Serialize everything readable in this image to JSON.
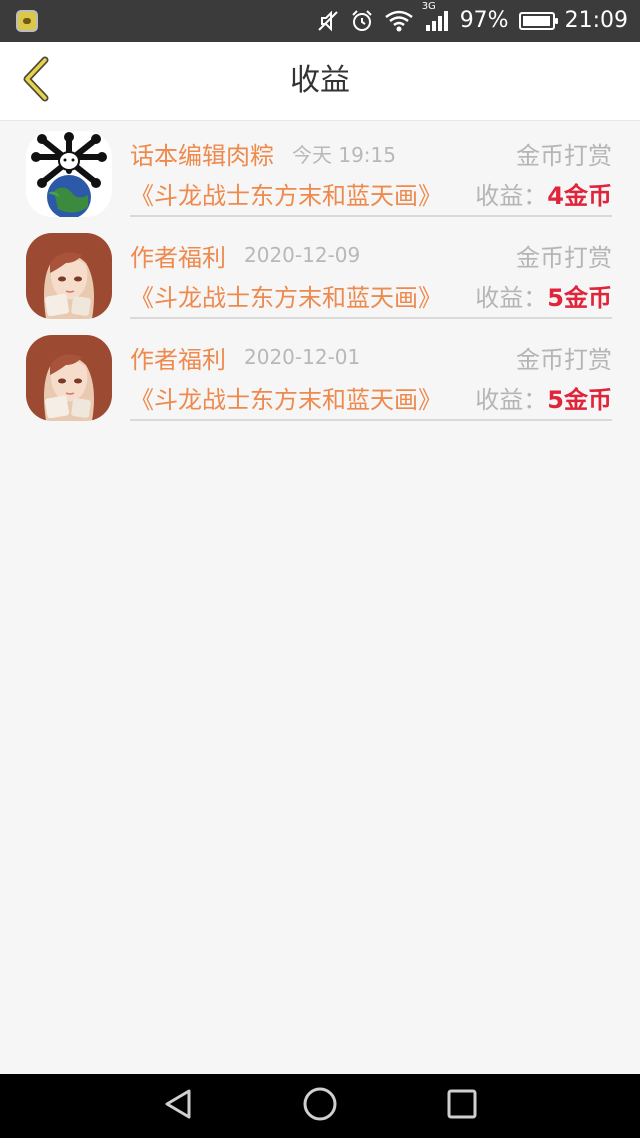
{
  "status_bar": {
    "battery_percent_text": "97%",
    "time": "21:09",
    "network": "3G",
    "battery_level": 0.97
  },
  "header": {
    "title": "收益",
    "back_icon": "chevron-left-icon"
  },
  "records": [
    {
      "name": "话本编辑肉粽",
      "time": "今天 19:15",
      "type": "金币打赏",
      "book": "《斗龙战士东方末和蓝天画》",
      "income_label": "收益：",
      "income_value": "4金币",
      "avatar": "skull-earth-avatar"
    },
    {
      "name": "作者福利",
      "time": "2020-12-09",
      "type": "金币打赏",
      "book": "《斗龙战士东方末和蓝天画》",
      "income_label": "收益：",
      "income_value": "5金币",
      "avatar": "anime-girl-avatar"
    },
    {
      "name": "作者福利",
      "time": "2020-12-01",
      "type": "金币打赏",
      "book": "《斗龙战士东方末和蓝天画》",
      "income_label": "收益：",
      "income_value": "5金币",
      "avatar": "anime-girl-avatar"
    }
  ],
  "colors": {
    "accent": "#ee8a4e",
    "income": "#e0243a",
    "muted": "#b5b5b5",
    "background": "#f6f6f6"
  }
}
